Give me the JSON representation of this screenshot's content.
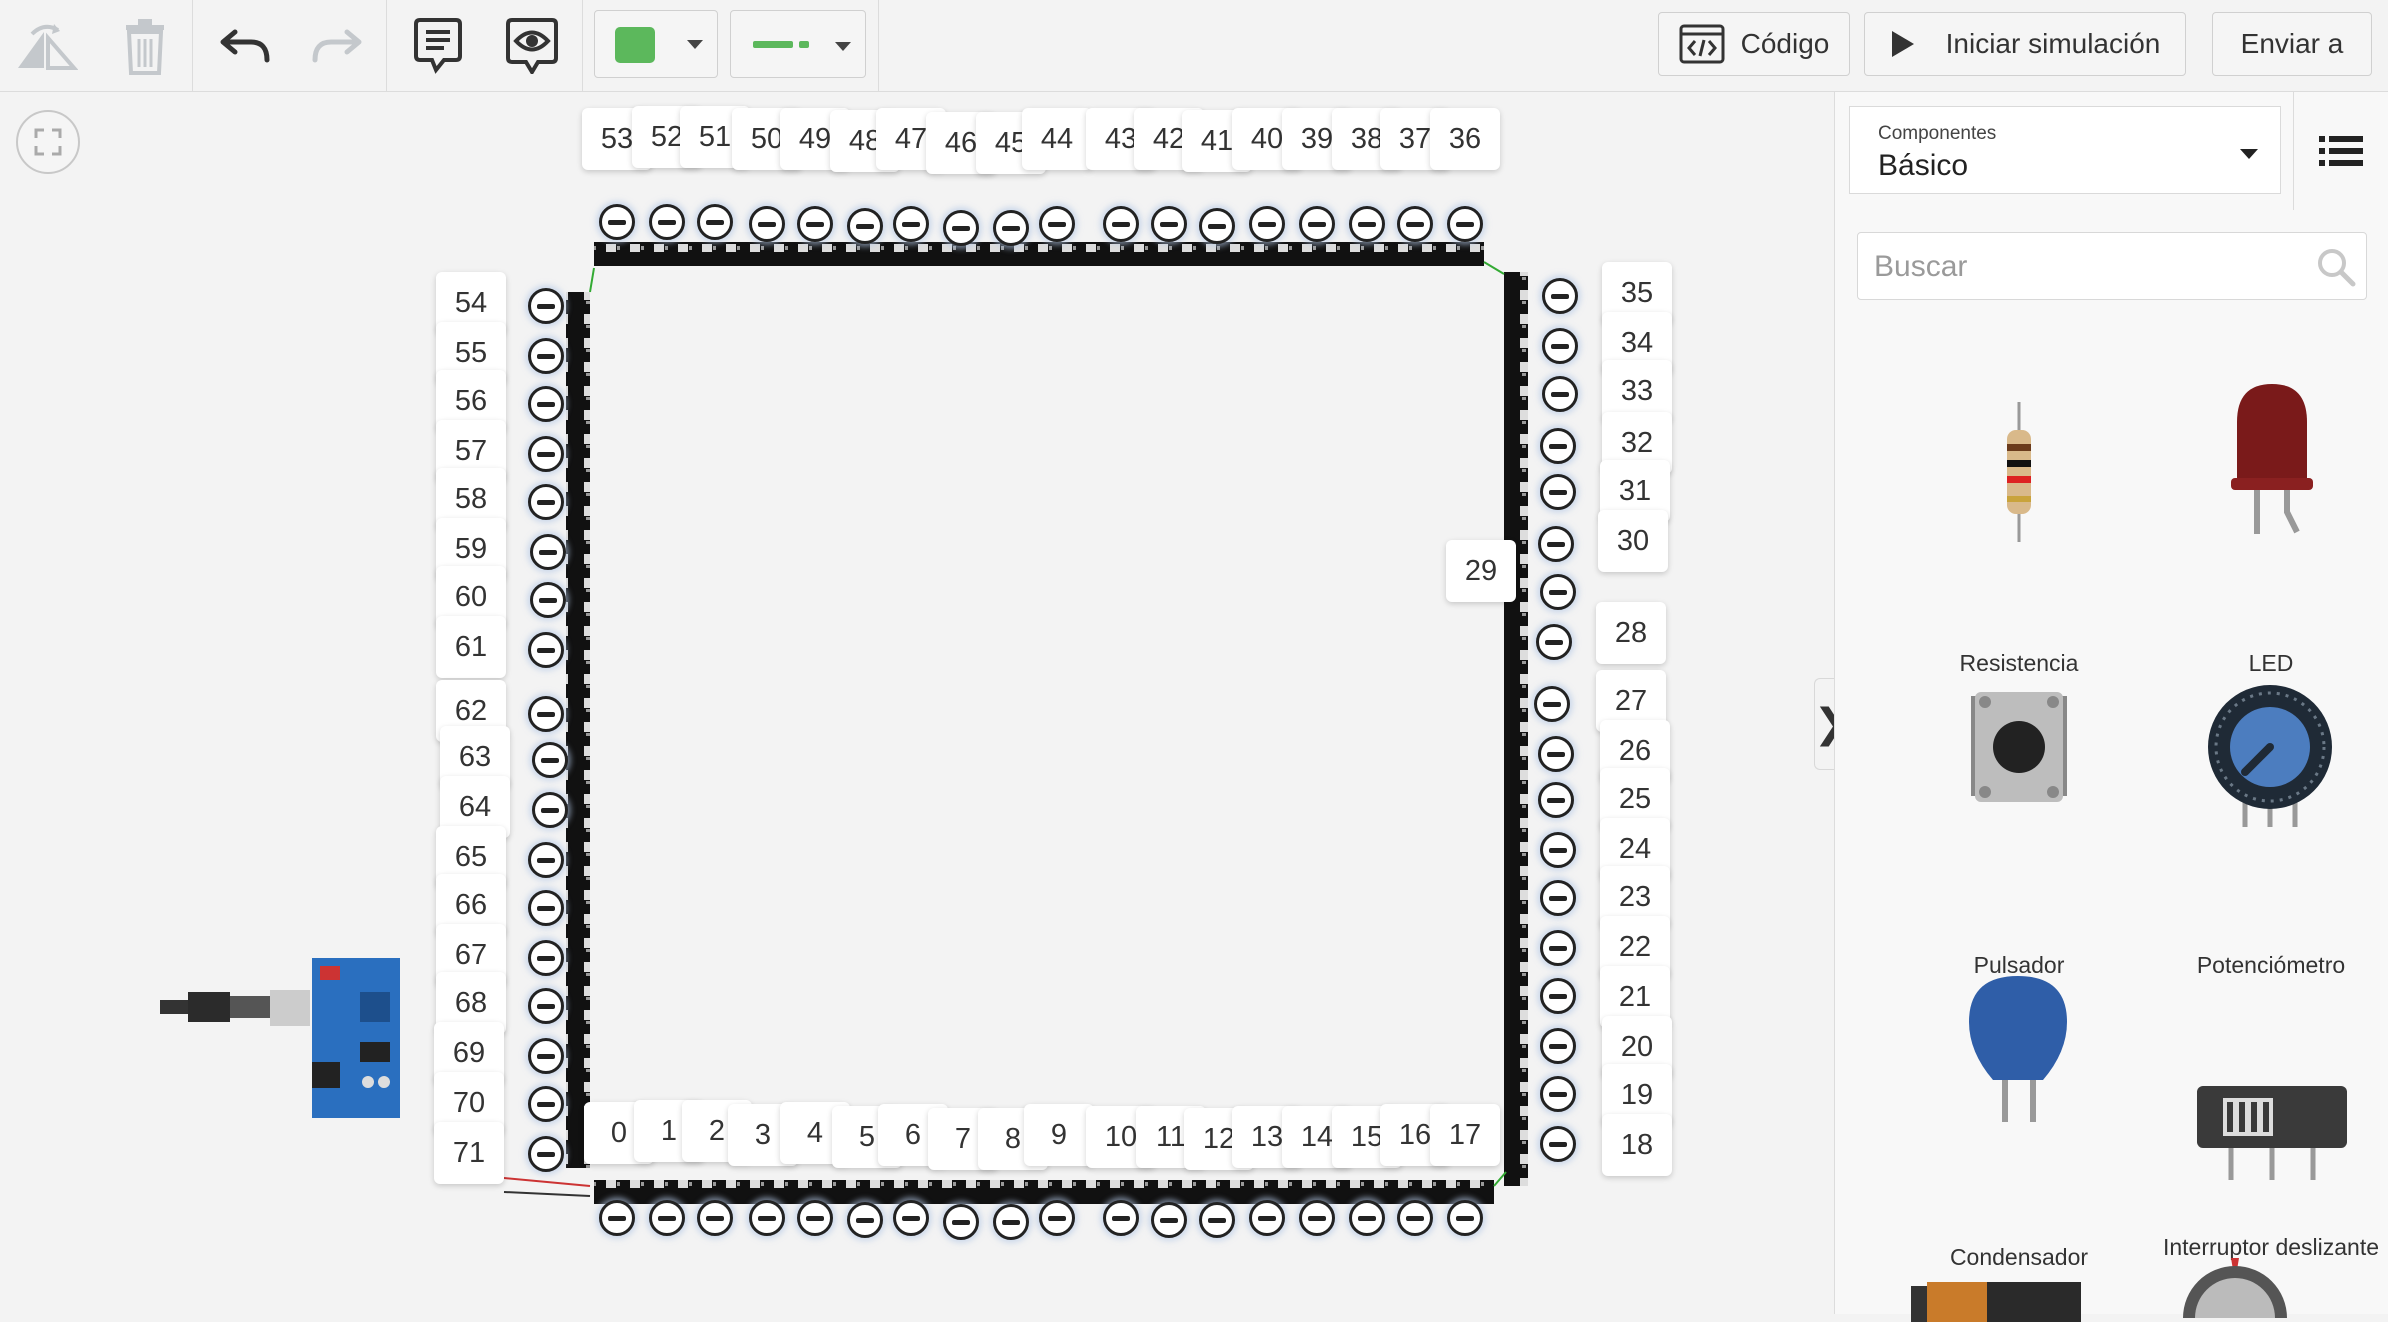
{
  "toolbar": {
    "code_label": "Código",
    "start_sim_label": "Iniciar simulación",
    "send_label": "Enviar a",
    "color_swatch": "#5cb85c",
    "icons": [
      "rotate-icon",
      "trash-icon",
      "undo-icon",
      "redo-icon",
      "notes-icon",
      "eye-icon",
      "code-icon",
      "play-icon"
    ]
  },
  "panel": {
    "components_caption": "Componentes",
    "components_value": "Básico",
    "search_placeholder": "Buscar",
    "items": [
      {
        "label": "Resistencia"
      },
      {
        "label": "LED"
      },
      {
        "label": "Pulsador"
      },
      {
        "label": "Potenciómetro"
      },
      {
        "label": "Condensador"
      },
      {
        "label": "Interruptor deslizante"
      }
    ]
  },
  "canvas": {
    "top_labels": [
      "53",
      "52",
      "51",
      "50",
      "49",
      "48",
      "47",
      "46",
      "45",
      "44",
      "43",
      "42",
      "41",
      "40",
      "39",
      "38",
      "37",
      "36"
    ],
    "right_labels": [
      "35",
      "34",
      "33",
      "32",
      "31",
      "30",
      "29",
      "28",
      "27",
      "26",
      "25",
      "24",
      "23",
      "22",
      "21",
      "20",
      "19",
      "18"
    ],
    "bottom_labels": [
      "0",
      "1",
      "2",
      "3",
      "4",
      "5",
      "6",
      "7",
      "8",
      "9",
      "10",
      "11",
      "12",
      "13",
      "14",
      "15",
      "16",
      "17"
    ],
    "left_labels": [
      "54",
      "55",
      "56",
      "57",
      "58",
      "59",
      "60",
      "61",
      "62",
      "63",
      "64",
      "65",
      "66",
      "67",
      "68",
      "69",
      "70",
      "71"
    ]
  }
}
